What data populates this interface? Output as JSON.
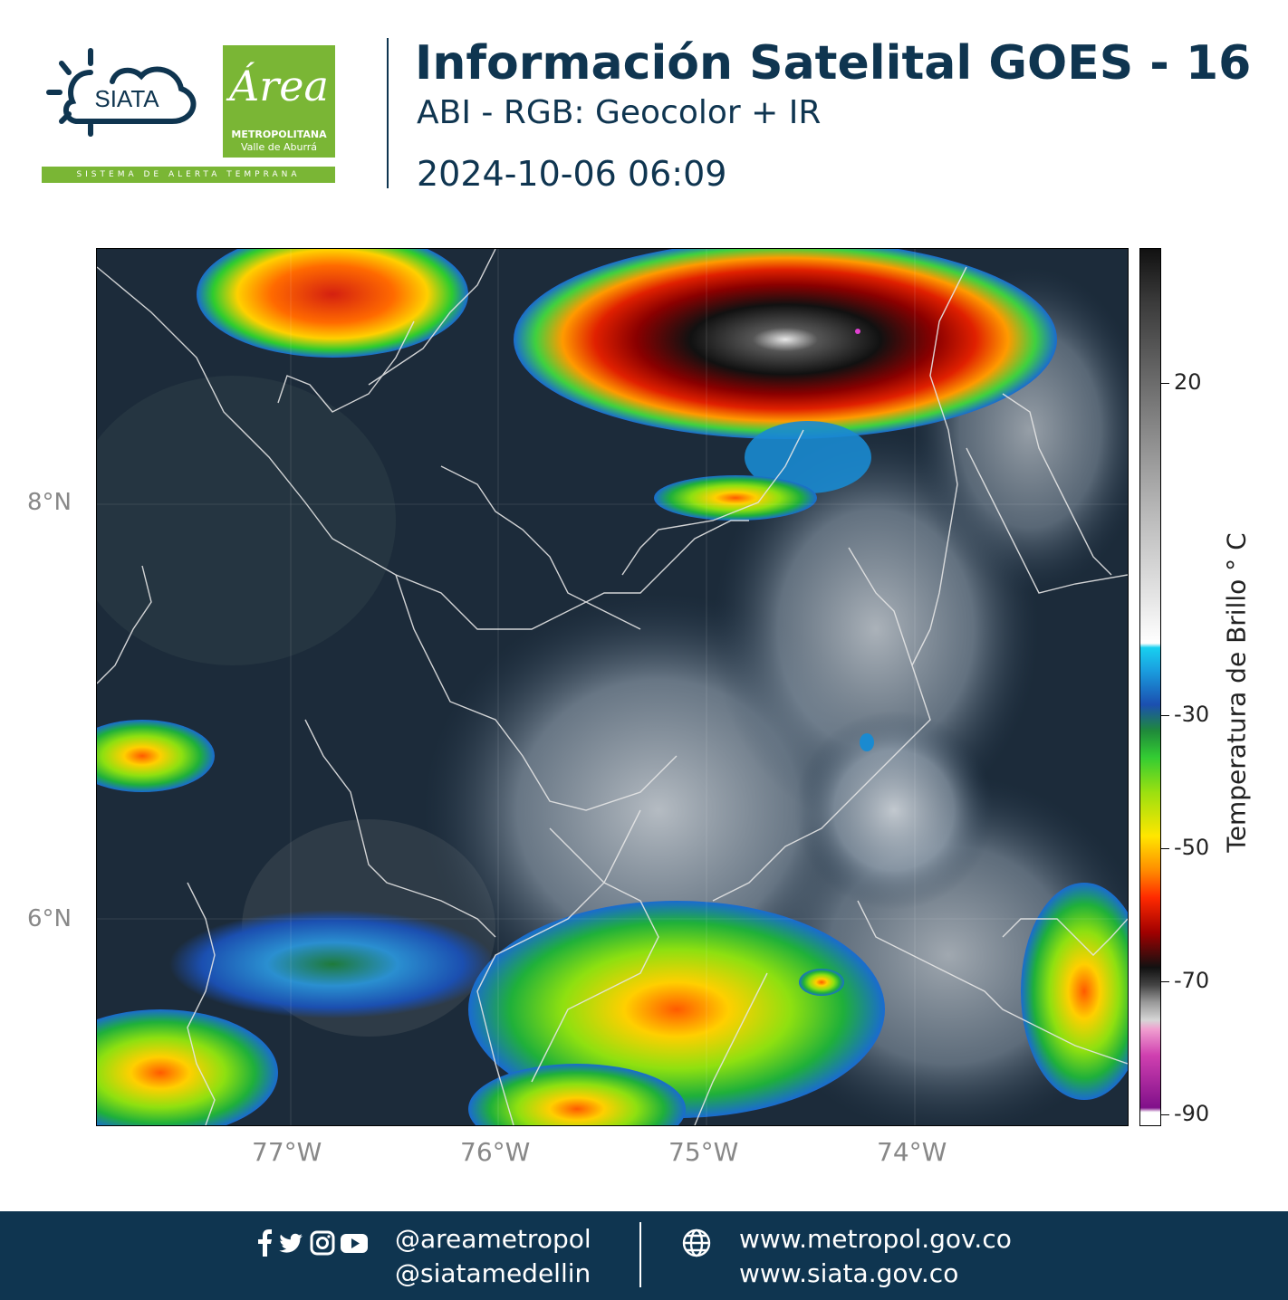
{
  "header": {
    "title": "Información Satelital GOES - 16",
    "subtitle": "ABI - RGB: Geocolor + IR",
    "timestamp": "2024-10-06 06:09"
  },
  "logos": {
    "siata": "SIATA",
    "area_title": "Área",
    "area_line1": "METROPOLITANA",
    "area_line2": "Valle de Aburrá",
    "tagline": "SISTEMA DE ALERTA TEMPRANA"
  },
  "map": {
    "lat_labels": [
      "8°N",
      "6°N"
    ],
    "lon_labels": [
      "77°W",
      "76°W",
      "75°W",
      "74°W"
    ],
    "extent": {
      "lon_min": -77.93,
      "lon_max": -72.97,
      "lat_min": 5.0,
      "lat_max": 9.23
    }
  },
  "colorbar": {
    "title": "Temperatura de Brillo  ° C",
    "tick_labels": [
      "20",
      "-30",
      "-50",
      "-70",
      "-90"
    ],
    "range": [
      -92,
      30
    ]
  },
  "footer": {
    "handle1": "@areametropol",
    "handle2": "@siatamedellin",
    "web1": "www.metropol.gov.co",
    "web2": "www.siata.gov.co",
    "icons": [
      "facebook-icon",
      "twitter-icon",
      "instagram-icon",
      "youtube-icon",
      "globe-icon"
    ]
  }
}
